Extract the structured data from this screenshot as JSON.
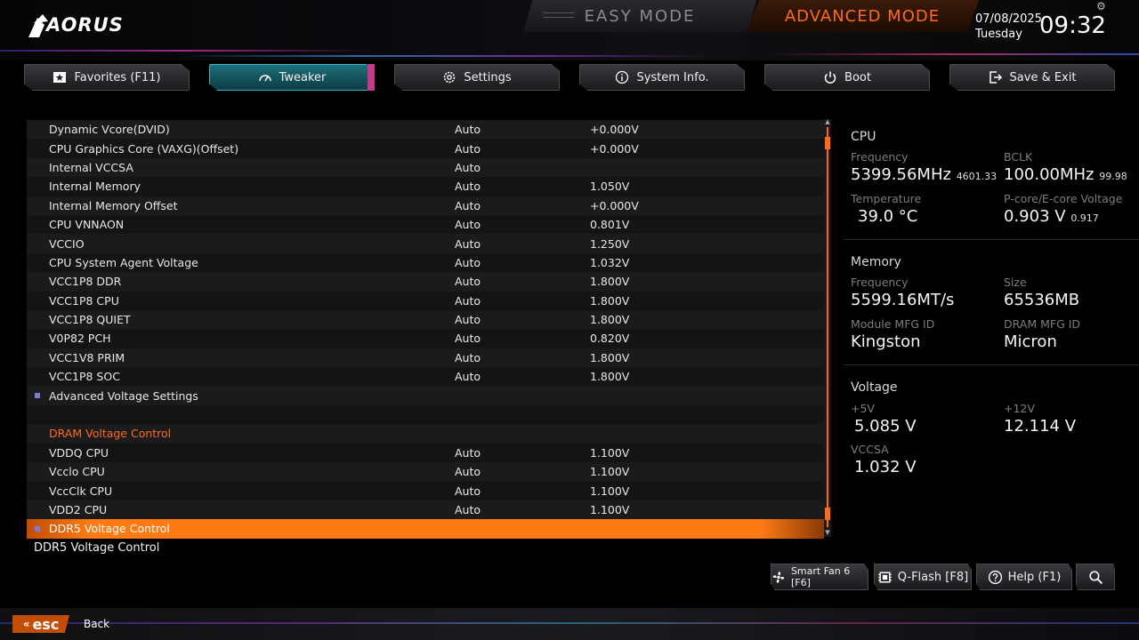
{
  "brand": {
    "logo_text": "AORUS"
  },
  "modes": {
    "easy": "EASY MODE",
    "advanced": "ADVANCED MODE"
  },
  "clock": {
    "date": "07/08/2025",
    "day": "Tuesday",
    "time": "09:32"
  },
  "tabs": [
    {
      "label": "Favorites (F11)",
      "icon": "star-icon"
    },
    {
      "label": "Tweaker",
      "icon": "speedometer-icon",
      "active": true
    },
    {
      "label": "Settings",
      "icon": "gear-icon"
    },
    {
      "label": "System Info.",
      "icon": "info-icon"
    },
    {
      "label": "Boot",
      "icon": "power-icon"
    },
    {
      "label": "Save & Exit",
      "icon": "exit-icon"
    }
  ],
  "settings": [
    {
      "name": "Dynamic Vcore(DVID)",
      "value": "Auto",
      "current": "+0.000V"
    },
    {
      "name": "CPU Graphics Core (VAXG)(Offset)",
      "value": "Auto",
      "current": "+0.000V"
    },
    {
      "name": "Internal VCCSA",
      "value": "Auto",
      "current": ""
    },
    {
      "name": "Internal Memory",
      "value": "Auto",
      "current": "1.050V"
    },
    {
      "name": "Internal Memory Offset",
      "value": "Auto",
      "current": "+0.000V"
    },
    {
      "name": "CPU VNNAON",
      "value": "Auto",
      "current": "0.801V"
    },
    {
      "name": "VCCIO",
      "value": "Auto",
      "current": "1.250V"
    },
    {
      "name": "CPU System Agent Voltage",
      "value": "Auto",
      "current": "1.032V"
    },
    {
      "name": "VCC1P8 DDR",
      "value": "Auto",
      "current": "1.800V"
    },
    {
      "name": "VCC1P8 CPU",
      "value": "Auto",
      "current": "1.800V"
    },
    {
      "name": "VCC1P8 QUIET",
      "value": "Auto",
      "current": "1.800V"
    },
    {
      "name": "V0P82 PCH",
      "value": "Auto",
      "current": "0.820V"
    },
    {
      "name": "VCC1V8 PRIM",
      "value": "Auto",
      "current": "1.800V"
    },
    {
      "name": "VCC1P8 SOC",
      "value": "Auto",
      "current": "1.800V"
    },
    {
      "name": "Advanced Voltage Settings",
      "value": "",
      "current": "",
      "submenu": true
    },
    {
      "name": "",
      "value": "",
      "current": ""
    },
    {
      "name": "DRAM Voltage Control",
      "value": "",
      "current": "",
      "section": true
    },
    {
      "name": "VDDQ CPU",
      "value": "Auto",
      "current": "1.100V"
    },
    {
      "name": "Vcclo CPU",
      "value": "Auto",
      "current": "1.100V"
    },
    {
      "name": "VccClk CPU",
      "value": "Auto",
      "current": "1.100V"
    },
    {
      "name": "VDD2 CPU",
      "value": "Auto",
      "current": "1.100V"
    },
    {
      "name": "DDR5 Voltage Control",
      "value": "",
      "current": "",
      "selected": true
    }
  ],
  "help_text": "DDR5 Voltage Control",
  "info": {
    "cpu": {
      "title": "CPU",
      "freq_label": "Frequency",
      "freq": "5399.56MHz",
      "freq_sub": "4601.33",
      "bclk_label": "BCLK",
      "bclk": "100.00MHz",
      "bclk_sub": "99.98",
      "temp_label": "Temperature",
      "temp": "39.0 °C",
      "volt_label": "P-core/E-core Voltage",
      "volt": "0.903 V",
      "volt_sub": "0.917"
    },
    "memory": {
      "title": "Memory",
      "freq_label": "Frequency",
      "freq": "5599.16MT/s",
      "size_label": "Size",
      "size": "65536MB",
      "module_label": "Module MFG ID",
      "module": "Kingston",
      "dram_label": "DRAM MFG ID",
      "dram": "Micron"
    },
    "voltage": {
      "title": "Voltage",
      "v5_label": "+5V",
      "v5": "5.085 V",
      "v12_label": "+12V",
      "v12": "12.114 V",
      "vccsa_label": "VCCSA",
      "vccsa": "1.032 V"
    }
  },
  "bottom": {
    "smart_fan": "Smart Fan 6 [F6]",
    "qflash": "Q-Flash [F8]",
    "help": "Help (F1)",
    "search_icon": "search-icon"
  },
  "esc": {
    "key": "esc",
    "label": "Back"
  },
  "colors": {
    "accent": "#ff6a1a",
    "active_tab": "#1f6f7a",
    "bg": "#000000"
  }
}
